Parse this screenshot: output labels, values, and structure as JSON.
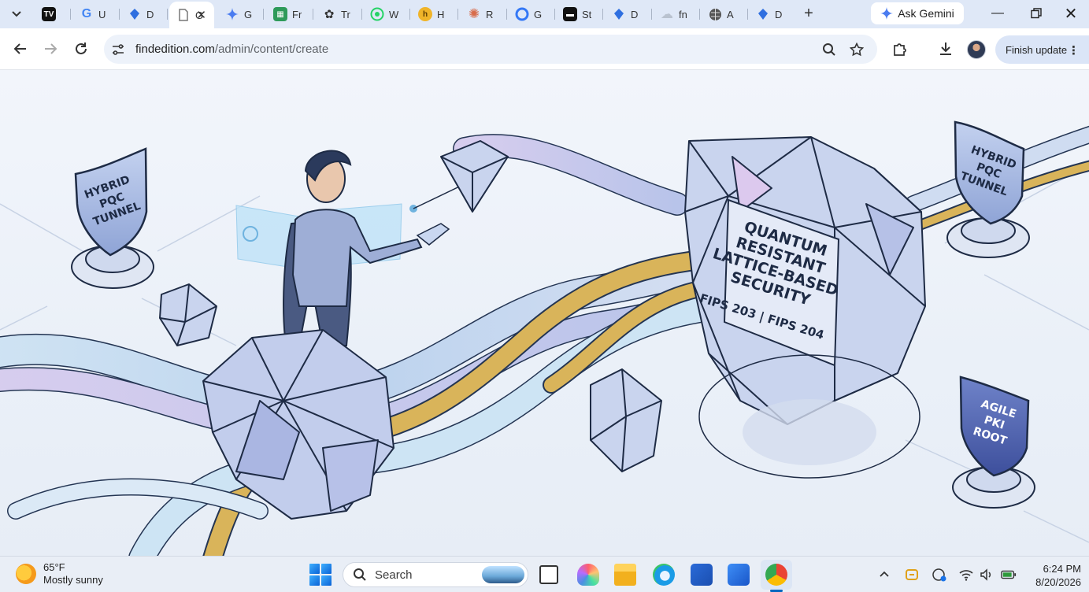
{
  "tabs": [
    {
      "label": "",
      "favicon": "tv-icon",
      "color": "#111111"
    },
    {
      "label": "U",
      "favicon": "google-icon",
      "color": "#4285f4"
    },
    {
      "label": "D",
      "favicon": "diamond-icon",
      "color": "#2f6fe0"
    },
    {
      "label": "G",
      "favicon": "doc-icon",
      "color": "#8a8a8a",
      "active": true
    },
    {
      "label": "G",
      "favicon": "gemini-icon",
      "color": "#4a7cf0"
    },
    {
      "label": "Fr",
      "favicon": "sheet-icon",
      "color": "#2e9a5a"
    },
    {
      "label": "Tr",
      "favicon": "openai-icon",
      "color": "#333333"
    },
    {
      "label": "W",
      "favicon": "whatsapp-icon",
      "color": "#25d366"
    },
    {
      "label": "H",
      "favicon": "honey-icon",
      "color": "#e8a317"
    },
    {
      "label": "R",
      "favicon": "claude-icon",
      "color": "#d86b4a"
    },
    {
      "label": "G",
      "favicon": "c-icon",
      "color": "#3478f6"
    },
    {
      "label": "St",
      "favicon": "monitor-icon",
      "color": "#111111"
    },
    {
      "label": "D",
      "favicon": "diamond-icon",
      "color": "#2f6fe0"
    },
    {
      "label": "fn",
      "favicon": "cloud-icon",
      "color": "#b9c2cf"
    },
    {
      "label": "A",
      "favicon": "globe-icon",
      "color": "#444444"
    },
    {
      "label": "D",
      "favicon": "diamond-icon",
      "color": "#2f6fe0"
    }
  ],
  "ask_gemini": "Ask Gemini",
  "url": {
    "domain": "findedition.com",
    "path": "/admin/content/create"
  },
  "finish_update": "Finish update",
  "artwork": {
    "center_label": [
      "QUANTUM",
      "RESISTANT",
      "LATTICE-BASED",
      "SECURITY"
    ],
    "center_sub": "FIPS 203 | FIPS 204",
    "shield_left": [
      "HYBRID",
      "PQC",
      "TUNNEL"
    ],
    "shield_right_top": [
      "HYBRID",
      "PQC",
      "TUNNEL"
    ],
    "shield_right_bottom": [
      "AGILE",
      "PKI",
      "ROOT"
    ]
  },
  "taskbar": {
    "temp": "65°F",
    "weather": "Mostly sunny",
    "search_label": "Search",
    "time": "6:24 PM",
    "date": "8/20/2026"
  },
  "colors": {
    "accent": "#0b57d0",
    "tab_strip": "#dfe8f7",
    "omnibox": "#edf2fa",
    "lattice_fill": "#c9d4ee",
    "gold": "#d9b45a"
  }
}
